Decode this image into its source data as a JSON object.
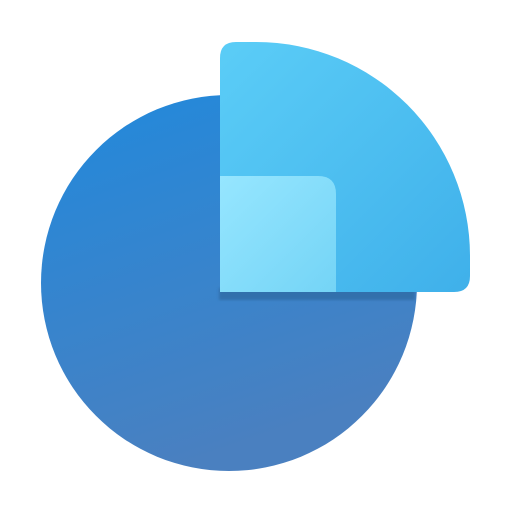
{
  "icon": {
    "name": "pie-chart-app-icon",
    "colors": {
      "background": "#ffffff",
      "circle_top": "#2189dc",
      "circle_bottom": "#4a80c0",
      "wedge_light": "#5bcdf7",
      "wedge_dark": "#3fb0ea",
      "inner_square_light": "#96e6ff",
      "inner_square_dark": "#74d4f6",
      "shadow": "#2f6aa3"
    }
  }
}
